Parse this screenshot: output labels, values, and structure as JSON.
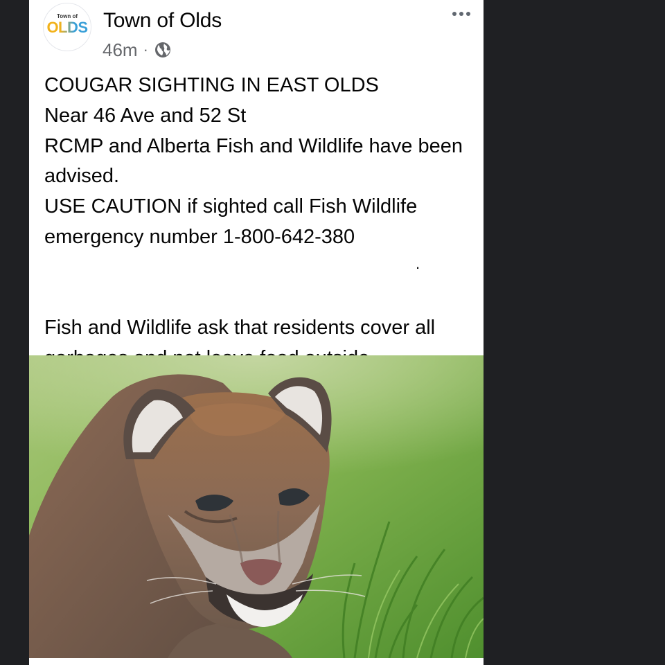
{
  "post": {
    "page_name": "Town of Olds",
    "timestamp": "46m",
    "separator": "·",
    "privacy_icon": "globe-icon",
    "more_icon": "more-dots-icon",
    "avatar": {
      "small_text": "Town of",
      "big_text": "OLDS",
      "colors": {
        "gold": "#f2b21b",
        "blue": "#3aa0d8"
      }
    },
    "body": {
      "line1": "COUGAR SIGHTING IN EAST OLDS",
      "line2": "Near 46 Ave and 52 St",
      "line3": "RCMP and Alberta Fish and Wildlife have been advised.",
      "line4": "USE CAUTION if sighted call Fish Wildlife emergency number 1-800-642-380",
      "stray_dot": ".",
      "line5": "Fish and Wildlife ask that residents cover all garbages and not leave food outside."
    },
    "photo": {
      "subject": "cougar",
      "icon": "cougar-photo"
    }
  },
  "colors": {
    "background": "#1f2023",
    "card": "#ffffff",
    "text": "#050505",
    "meta": "#65676b"
  }
}
